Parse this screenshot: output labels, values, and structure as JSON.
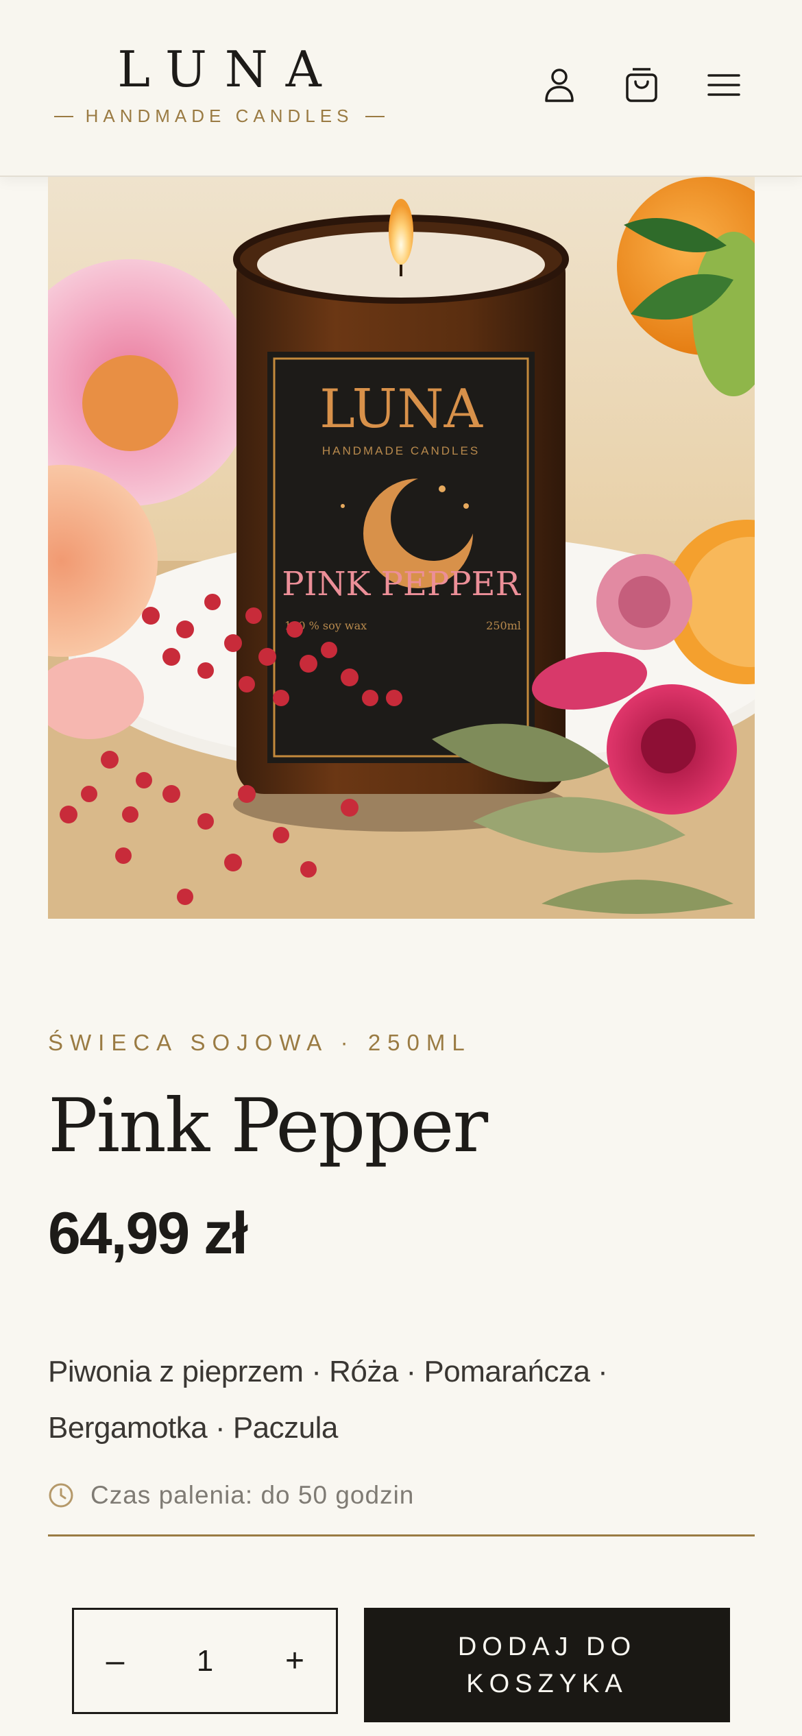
{
  "header": {
    "brand": "LUNA",
    "tagline": "HANDMADE CANDLES",
    "icons": [
      "user-icon",
      "shopping-bag-icon",
      "menu-icon"
    ]
  },
  "product_image": {
    "jar_brand": "LUNA",
    "jar_tagline": "HANDMADE CANDLES",
    "jar_name": "PINK PEPPER",
    "jar_wax": "100 % soy wax",
    "jar_volume": "250ml"
  },
  "product": {
    "category": "ŚWIECA SOJOWA · 250ML",
    "name": "Pink Pepper",
    "price": "64,99 zł",
    "notes_line1": "Piwonia z pieprzem · Róża · Pomarańcza ·",
    "notes_line2": "Bergamotka · Paczula",
    "burn_time": "Czas palenia: do 50 godzin"
  },
  "cart": {
    "decrement": "–",
    "quantity": "1",
    "increment": "+",
    "add_label": "DODAJ DO KOSZYKA"
  },
  "colors": {
    "background": "#f9f7f1",
    "accent_gold": "#9a7b43",
    "text_dark": "#1d1b18",
    "button_dark": "#1a1814"
  }
}
